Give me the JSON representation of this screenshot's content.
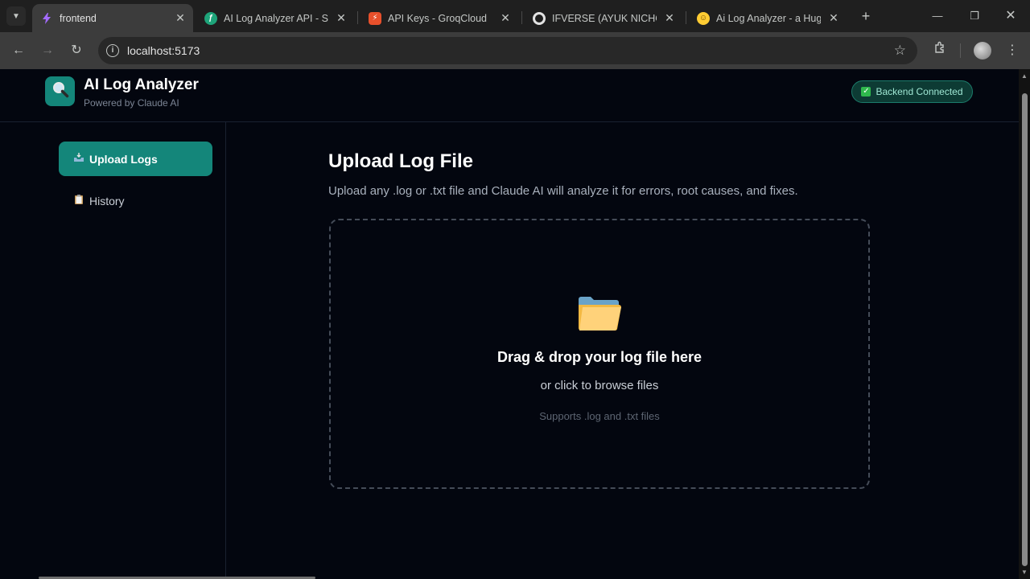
{
  "browser": {
    "tabs": [
      {
        "title": "frontend",
        "active": true
      },
      {
        "title": "AI Log Analyzer API - Swa",
        "active": false
      },
      {
        "title": "API Keys - GroqCloud",
        "active": false
      },
      {
        "title": "IFVERSE (AYUK NICHOLA",
        "active": false
      },
      {
        "title": "Ai Log Analyzer - a Hugg",
        "active": false
      }
    ],
    "url": "localhost:5173"
  },
  "header": {
    "title": "AI Log Analyzer",
    "subtitle": "Powered by Claude AI",
    "status": "Backend Connected",
    "accent_color": "#14867a"
  },
  "sidebar": {
    "items": [
      {
        "label": "Upload Logs",
        "icon": "inbox-tray-icon",
        "active": true
      },
      {
        "label": "History",
        "icon": "clipboard-icon",
        "active": false
      }
    ]
  },
  "main": {
    "title": "Upload Log File",
    "description": "Upload any .log or .txt file and Claude AI will analyze it for errors, root causes, and fixes.",
    "dropzone": {
      "title": "Drag & drop your log file here",
      "subtitle": "or click to browse files",
      "note": "Supports .log and .txt files",
      "icon": "folder-icon"
    }
  }
}
